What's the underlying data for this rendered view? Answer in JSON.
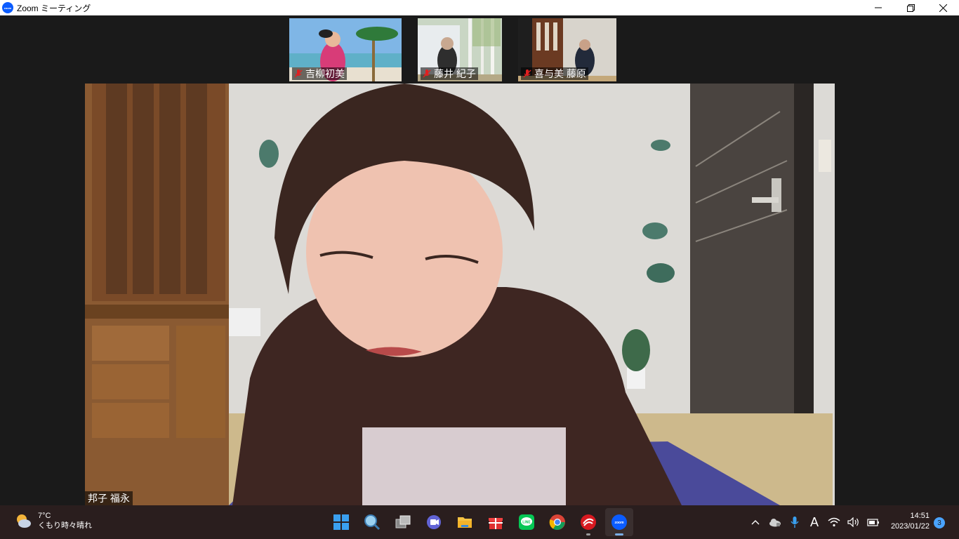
{
  "window": {
    "title": "Zoom ミーティング",
    "app_icon_text": "zoom"
  },
  "participants": [
    {
      "name": "吉柳初美",
      "muted": true
    },
    {
      "name": "藤井 紀子",
      "muted": true
    },
    {
      "name": "喜与美 藤原",
      "muted": true
    }
  ],
  "active_speaker": {
    "name": "邦子 福永"
  },
  "taskbar": {
    "weather": {
      "temp": "7°C",
      "desc": "くもり時々晴れ"
    },
    "apps": [
      "start-icon",
      "search-icon",
      "task-view-icon",
      "teams-chat-icon",
      "file-explorer-icon",
      "gift-icon",
      "line-icon",
      "chrome-icon",
      "trend-micro-icon",
      "zoom-icon"
    ],
    "ime_label": "A",
    "clock": {
      "time": "14:51",
      "date": "2023/01/22"
    },
    "notification_count": "3"
  },
  "colors": {
    "zoom_blue": "#0b5cff",
    "muted_red": "#e02020",
    "taskbar_bg": "#2a1e1e",
    "stage_bg": "#1a1a1a"
  }
}
